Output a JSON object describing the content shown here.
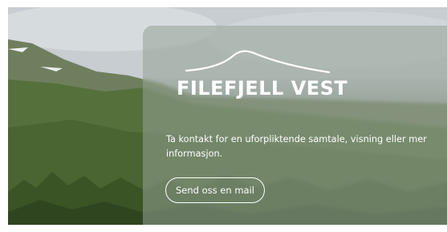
{
  "hero": {
    "background": "mountain-forest-landscape-photo"
  },
  "card": {
    "logo_icon": "mountain-ridge-logo",
    "logo_text": "FILEFJELL VEST",
    "contact_text": "Ta kontakt for en uforpliktende samtale, visning eller mer informasjon.",
    "button_label": "Send oss en mail"
  },
  "colors": {
    "text": "#ffffff",
    "card_overlay": "#96a296",
    "forest": "#3c5228",
    "sky": "#c9cfd3"
  }
}
